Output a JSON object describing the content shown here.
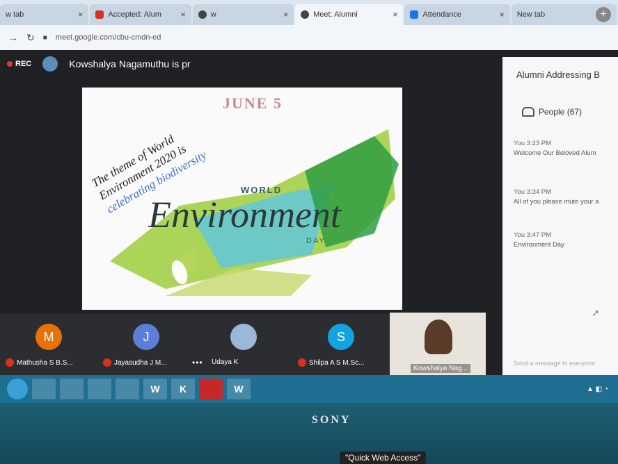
{
  "browser": {
    "tabs": [
      {
        "label": "w tab",
        "active": false,
        "icon": "blank"
      },
      {
        "label": "Accepted: Alum",
        "active": false,
        "icon": "gmail-icon",
        "color": "#d93025"
      },
      {
        "label": "w",
        "active": false,
        "icon": "search-icon"
      },
      {
        "label": "Meet: Alumni",
        "active": true,
        "icon": "meet-icon"
      },
      {
        "label": "Attendance",
        "active": false,
        "icon": "doc-icon",
        "color": "#1a73e8"
      },
      {
        "label": "New tab",
        "active": false,
        "icon": "blank"
      }
    ],
    "url": "meet.google.com/cbu-cmdn-ed"
  },
  "meet": {
    "rec_label": "REC",
    "presenting_text": "Kowshalya Nagamuthu is pr",
    "slide": {
      "date": "JUNE 5",
      "quote_line1": "The theme of World",
      "quote_line2": "Environment 2020 is",
      "quote_line3": "celebrating biodiversity",
      "world": "WORLD",
      "environment": "Environment",
      "day": "DAY"
    },
    "panel": {
      "title": "Alumni Addressing B",
      "people_label": "People (67)",
      "messages": [
        {
          "meta": "You  3:23 PM",
          "text": "Welcome Our Beloved Alum"
        },
        {
          "meta": "You  3:34 PM",
          "text": "All of you please mute your a"
        },
        {
          "meta": "You  3:47 PM",
          "text": "Environment Day"
        }
      ],
      "input_placeholder": "Send a message to everyone"
    },
    "participants": [
      {
        "initial": "M",
        "name": "Mathusha S B.S...",
        "color": "#e8710a",
        "muted": true
      },
      {
        "initial": "J",
        "name": "Jayasudha J M...",
        "color": "#5b7fd8",
        "muted": true
      },
      {
        "initial": "",
        "name": "Udaya K",
        "color": "#9bb8d8",
        "muted": false
      },
      {
        "initial": "S",
        "name": "Shilpa A S M.Sc...",
        "color": "#12a4e0",
        "muted": true
      }
    ],
    "self_name": "Kowshalya Nag..."
  },
  "taskbar": {
    "items": [
      "",
      "W",
      "K",
      "",
      "W"
    ]
  },
  "bezel": {
    "brand": "SONY",
    "watermark": "\"Quick Web Access\""
  },
  "colors": {
    "meet_bg": "#202124",
    "accent": "#1f6f93",
    "rec": "#e53935"
  }
}
